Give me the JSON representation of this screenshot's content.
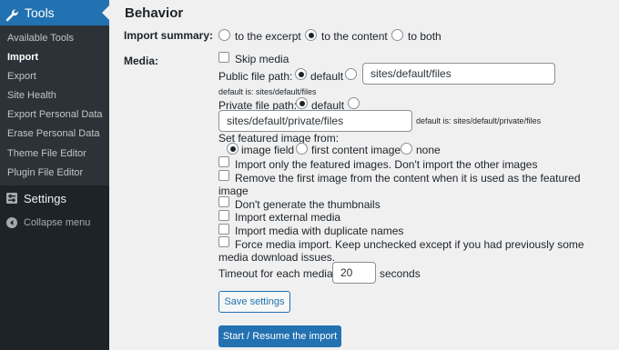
{
  "sidebar": {
    "tools_label": "Tools",
    "tools_icon": "wrench-icon",
    "submenu": [
      {
        "label": "Available Tools"
      },
      {
        "label": "Import"
      },
      {
        "label": "Export"
      },
      {
        "label": "Site Health"
      },
      {
        "label": "Export Personal Data"
      },
      {
        "label": "Erase Personal Data"
      },
      {
        "label": "Theme File Editor"
      },
      {
        "label": "Plugin File Editor"
      }
    ],
    "current_item": "Import",
    "settings_label": "Settings",
    "settings_icon": "settings-icon",
    "collapse_label": "Collapse menu",
    "collapse_icon": "collapse-arrow-icon"
  },
  "main": {
    "section_title": "Behavior",
    "import_summary": {
      "label": "Import summary:",
      "options": [
        "to the excerpt",
        "to the content",
        "to both"
      ],
      "selected": "to the content"
    },
    "media": {
      "label": "Media:",
      "skip_media_label": "Skip media",
      "public_path": {
        "label": "Public file path:",
        "default_label": "default",
        "default_selected": true,
        "value": "sites/default/files",
        "hint": "default is: sites/default/files"
      },
      "private_path": {
        "label": "Private file path:",
        "default_label": "default",
        "default_selected": true,
        "value": "sites/default/private/files",
        "hint": "default is: sites/default/private/files"
      },
      "featured_image": {
        "label": "Set featured image from:",
        "options": [
          "image field",
          "first content image",
          "none"
        ],
        "selected": "image field"
      },
      "options": [
        {
          "label": "Import only the featured images. Don't import the other images"
        },
        {
          "line1": "Remove the first image from the content when it is used as the featured",
          "line2": "image"
        },
        {
          "label": "Don't generate the thumbnails"
        },
        {
          "label": "Import external media"
        },
        {
          "label": "Import media with duplicate names"
        },
        {
          "line1": "Force media import. Keep unchecked except if you had previously some",
          "line2": "media download issues."
        }
      ],
      "timeout": {
        "label": "Timeout for each media:",
        "value": "20",
        "unit": "seconds"
      }
    },
    "save_button": "Save settings",
    "start_button": "Start / Resume the import"
  },
  "colors": {
    "sidebar_bg": "#1d2327",
    "submenu_bg": "#2c3338",
    "accent": "#2271b1",
    "content_bg": "#f0f0f1"
  }
}
